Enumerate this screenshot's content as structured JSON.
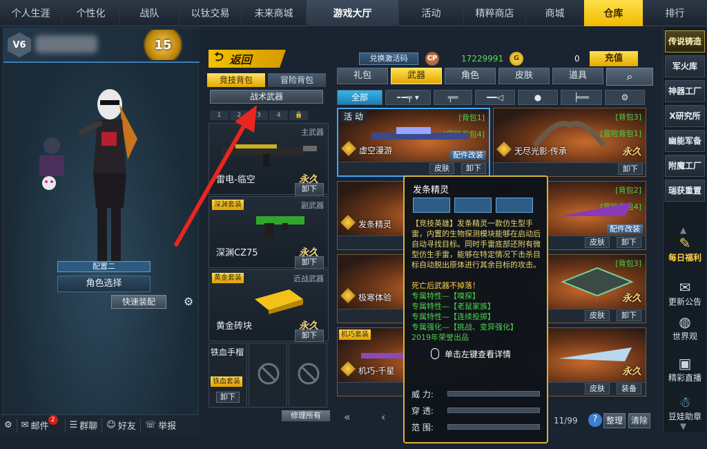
{
  "nav": {
    "tabs": [
      "个人生涯",
      "个性化",
      "战队",
      "以钛交易",
      "未来商城",
      "游戏大厅",
      "活动",
      "精粹商店",
      "商城",
      "仓库",
      "排行"
    ]
  },
  "left": {
    "rank_badge": "V6",
    "level": "15",
    "loadout_name": "配置二",
    "role_select": "角色选择",
    "quick_equip": "快速装配"
  },
  "bottombar": {
    "mail": "邮件",
    "mail_count": "2",
    "group_chat": "群聊",
    "friends": "好友",
    "report": "举报"
  },
  "backpack": {
    "back": "返回",
    "tab_competitive": "竞技背包",
    "tab_adventure": "冒险背包",
    "tactical": "战术武器",
    "slots": [
      "1",
      "2",
      "3",
      "4"
    ],
    "weapons": [
      {
        "category": "主武器",
        "name": "雷电-临空",
        "perm": "永久",
        "unequip": "卸下",
        "set": ""
      },
      {
        "category": "副武器",
        "name": "深渊CZ75",
        "perm": "永久",
        "unequip": "卸下",
        "set": "深渊套装"
      },
      {
        "category": "近战武器",
        "name": "黄金砖块",
        "perm": "永久",
        "unequip": "卸下",
        "set": "黄金套装"
      }
    ],
    "throwable": {
      "name": "铁血手榴",
      "set": "铁血套装",
      "unequip": "卸下"
    },
    "repair_all": "修理所有"
  },
  "wallet": {
    "redeem": "兑换激活码",
    "cp_icon": "CP",
    "cp_amount": "17229991",
    "g_icon": "G",
    "g_amount": "0",
    "recharge": "充值"
  },
  "categories": {
    "tabs": [
      "礼包",
      "武器",
      "角色",
      "皮肤",
      "道具"
    ],
    "active": "武器",
    "search_icon": "search-icon"
  },
  "subfilters": {
    "all": "全部"
  },
  "items": [
    {
      "name": "虚空漫游",
      "bag": "[背包1]",
      "bag2": "[冒险背包4]",
      "perm": "",
      "tag": "活 动",
      "mod": "配件改装",
      "buttons": [
        "皮肤",
        "卸下"
      ]
    },
    {
      "name": "无尽光影·传承",
      "bag": "[背包3]",
      "bag2": "[冒险背包1]",
      "perm": "永久",
      "tag": "",
      "mod": "",
      "buttons": [
        "卸下"
      ]
    },
    {
      "name": "发条精灵",
      "bag": "",
      "bag2": "",
      "perm": "",
      "tag": "",
      "mod": "",
      "buttons": []
    },
    {
      "name": "",
      "bag": "[背包2]",
      "bag2": "[冒险背包4]",
      "perm": "",
      "tag": "",
      "mod": "配件改装",
      "buttons": [
        "皮肤",
        "卸下"
      ]
    },
    {
      "name": "极寒体验",
      "bag": "",
      "bag2": "",
      "perm": "",
      "tag": "",
      "mod": "",
      "buttons": []
    },
    {
      "name": "",
      "bag": "[背包3]",
      "bag2": "",
      "perm": "永久",
      "tag": "",
      "mod": "",
      "buttons": [
        "皮肤",
        "卸下"
      ]
    },
    {
      "name": "机巧-千星",
      "bag": "",
      "bag2": "",
      "perm": "",
      "tag": "机巧套装",
      "mod": "",
      "buttons": []
    },
    {
      "name": "",
      "bag": "",
      "bag2": "",
      "perm": "永久",
      "tag": "",
      "mod": "",
      "buttons": [
        "皮肤",
        "装备"
      ]
    }
  ],
  "tooltip": {
    "title": "发条精灵",
    "desc": "【竞技英雄】发条精灵一款仿生型手雷，内置的生物探测模块能够在启动后自动寻找目标。同时手雷底部还附有微型仿生手雷，能够在特定情况下击杀目标自动脱出原体进行其余目标的攻击。",
    "no_drop": "死亡后武器不掉落！",
    "traits": [
      "专属特性—【嗅探】",
      "专属特性—【老鼠家族】",
      "专属特性—【连续投掷】",
      "专属强化—【挑战、变异强化】"
    ],
    "year": "2019年荣誉出品",
    "hint": "单击左键查看详情",
    "stats": [
      "威  力:",
      "穿  透:",
      "范  围:"
    ]
  },
  "pagination": {
    "page": "11/99",
    "sort": "整理",
    "clear": "清除"
  },
  "rightbar": {
    "items": [
      "传说铸造",
      "军火库",
      "神器工厂",
      "X研究所",
      "幽能军备",
      "附魔工厂",
      "瑞获重置"
    ],
    "daily": "每日福利",
    "news": "更新公告",
    "world": "世界观",
    "live": "精彩直播",
    "helper": "豆娃助章"
  }
}
